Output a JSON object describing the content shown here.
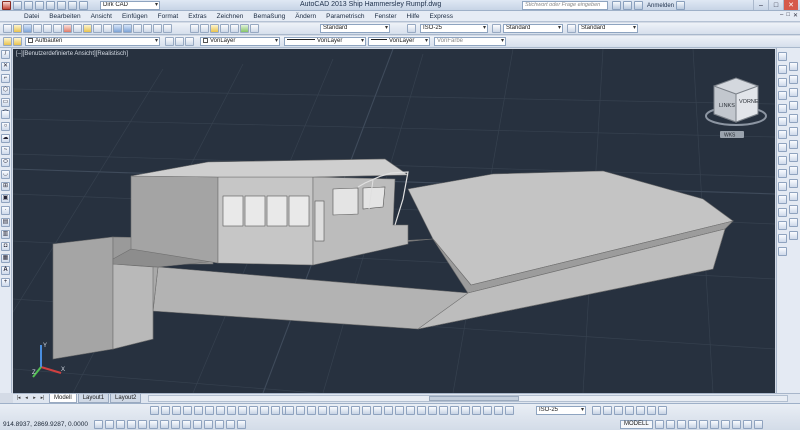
{
  "window": {
    "title": "AutoCAD 2013   Ship Hammersley Rumpf.dwg",
    "search_placeholder": "Stichwort oder Frage eingeben",
    "login_label": "Anmelden",
    "min_glyph": "–",
    "max_glyph": "□",
    "close_glyph": "✕"
  },
  "menu": {
    "items": [
      "Datei",
      "Bearbeiten",
      "Ansicht",
      "Einfügen",
      "Format",
      "Extras",
      "Zeichnen",
      "Bemaßung",
      "Ändern",
      "Parametrisch",
      "Fenster",
      "Hilfe",
      "Express"
    ],
    "mdi_buttons": [
      "–",
      "□",
      "✕"
    ]
  },
  "toolbar1": {
    "workspace": "Dirk CAD",
    "textstyle": "Standard",
    "dimstyle": "ISO-25",
    "tablestyle": "Standard",
    "mleaderstyle": "Standard"
  },
  "toolbar2": {
    "layer": "Aufbauten",
    "color": "VonLayer",
    "linetype": "VonLayer",
    "lineweight": "VonLayer",
    "plotstyle": "VonFarbe"
  },
  "viewport": {
    "label": "[–][Benutzerdefinierte Ansicht][Realistisch]",
    "viewcube_faces": [
      "LINKS",
      "VORNE"
    ],
    "wcs_label": "WKS",
    "ucs_axes": [
      "Y",
      "X",
      "Z"
    ]
  },
  "left_tools": [
    "line",
    "xline",
    "pline",
    "polygon",
    "rectangle",
    "arc",
    "circle",
    "revcloud",
    "spline",
    "ellipse",
    "ellipse-arc",
    "insert",
    "block",
    "point",
    "hatch",
    "gradient",
    "region",
    "table",
    "mtext",
    "add-selected"
  ],
  "left_tool_text_glyph": "A",
  "tabs": {
    "items": [
      "Modell",
      "Layout1",
      "Layout2"
    ],
    "active": "Modell",
    "nav": [
      "|◂",
      "◂",
      "▸",
      "▸|"
    ]
  },
  "status": {
    "coordinates": "914.8937,  2869.9287, 0.0000",
    "dimstyle": "ISO-25",
    "space": "MODELL"
  },
  "colors": {
    "viewport_bg": "#27313f",
    "hull": "#b9b9b9"
  }
}
